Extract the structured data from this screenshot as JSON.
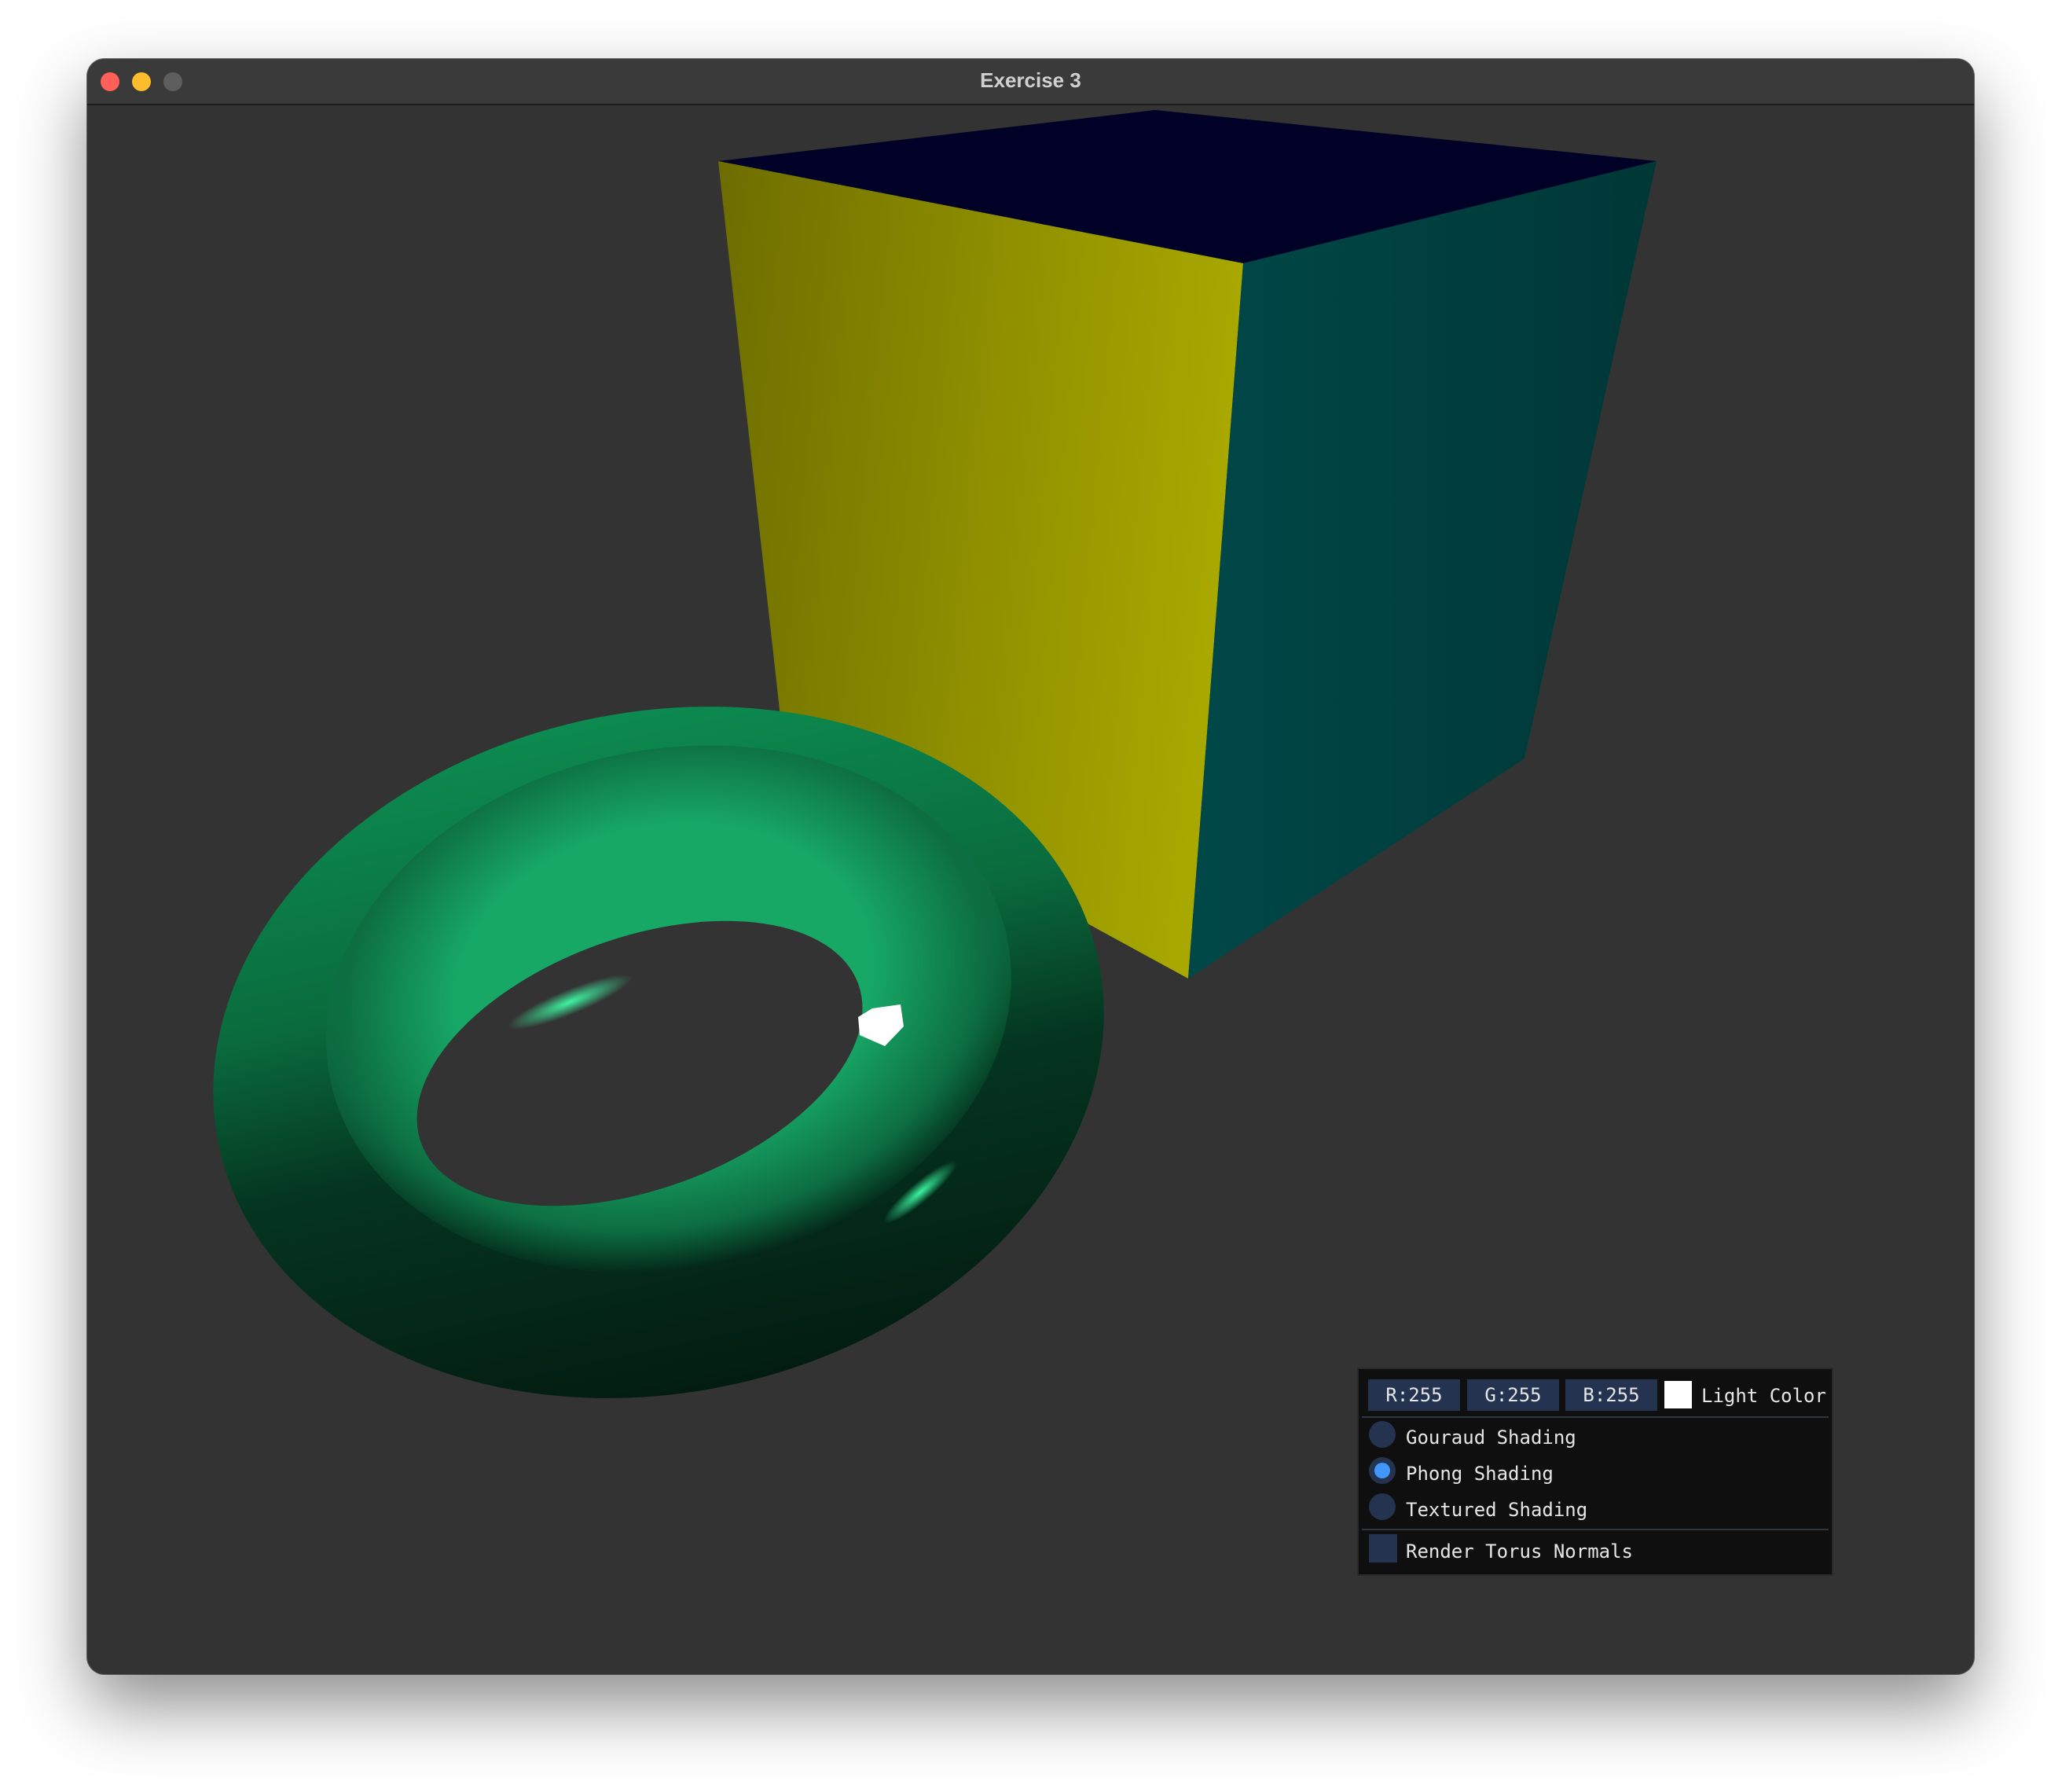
{
  "window": {
    "title": "Exercise 3"
  },
  "scene": {
    "objects": [
      "cube",
      "torus",
      "light-source"
    ],
    "colors": {
      "background": "#333333",
      "cube_top": "#010128",
      "cube_front": "#a5a500",
      "cube_right": "#004141",
      "torus": "#14a064",
      "light": "#ffffff"
    }
  },
  "controls": {
    "light_color": {
      "r_label": "R:255",
      "g_label": "G:255",
      "b_label": "B:255",
      "label": "Light Color",
      "swatch": "#ffffff"
    },
    "shading_options": [
      {
        "label": "Gouraud Shading",
        "selected": false
      },
      {
        "label": "Phong Shading",
        "selected": true
      },
      {
        "label": "Textured Shading",
        "selected": false
      }
    ],
    "render_normals": {
      "label": "Render Torus Normals",
      "checked": false
    }
  }
}
